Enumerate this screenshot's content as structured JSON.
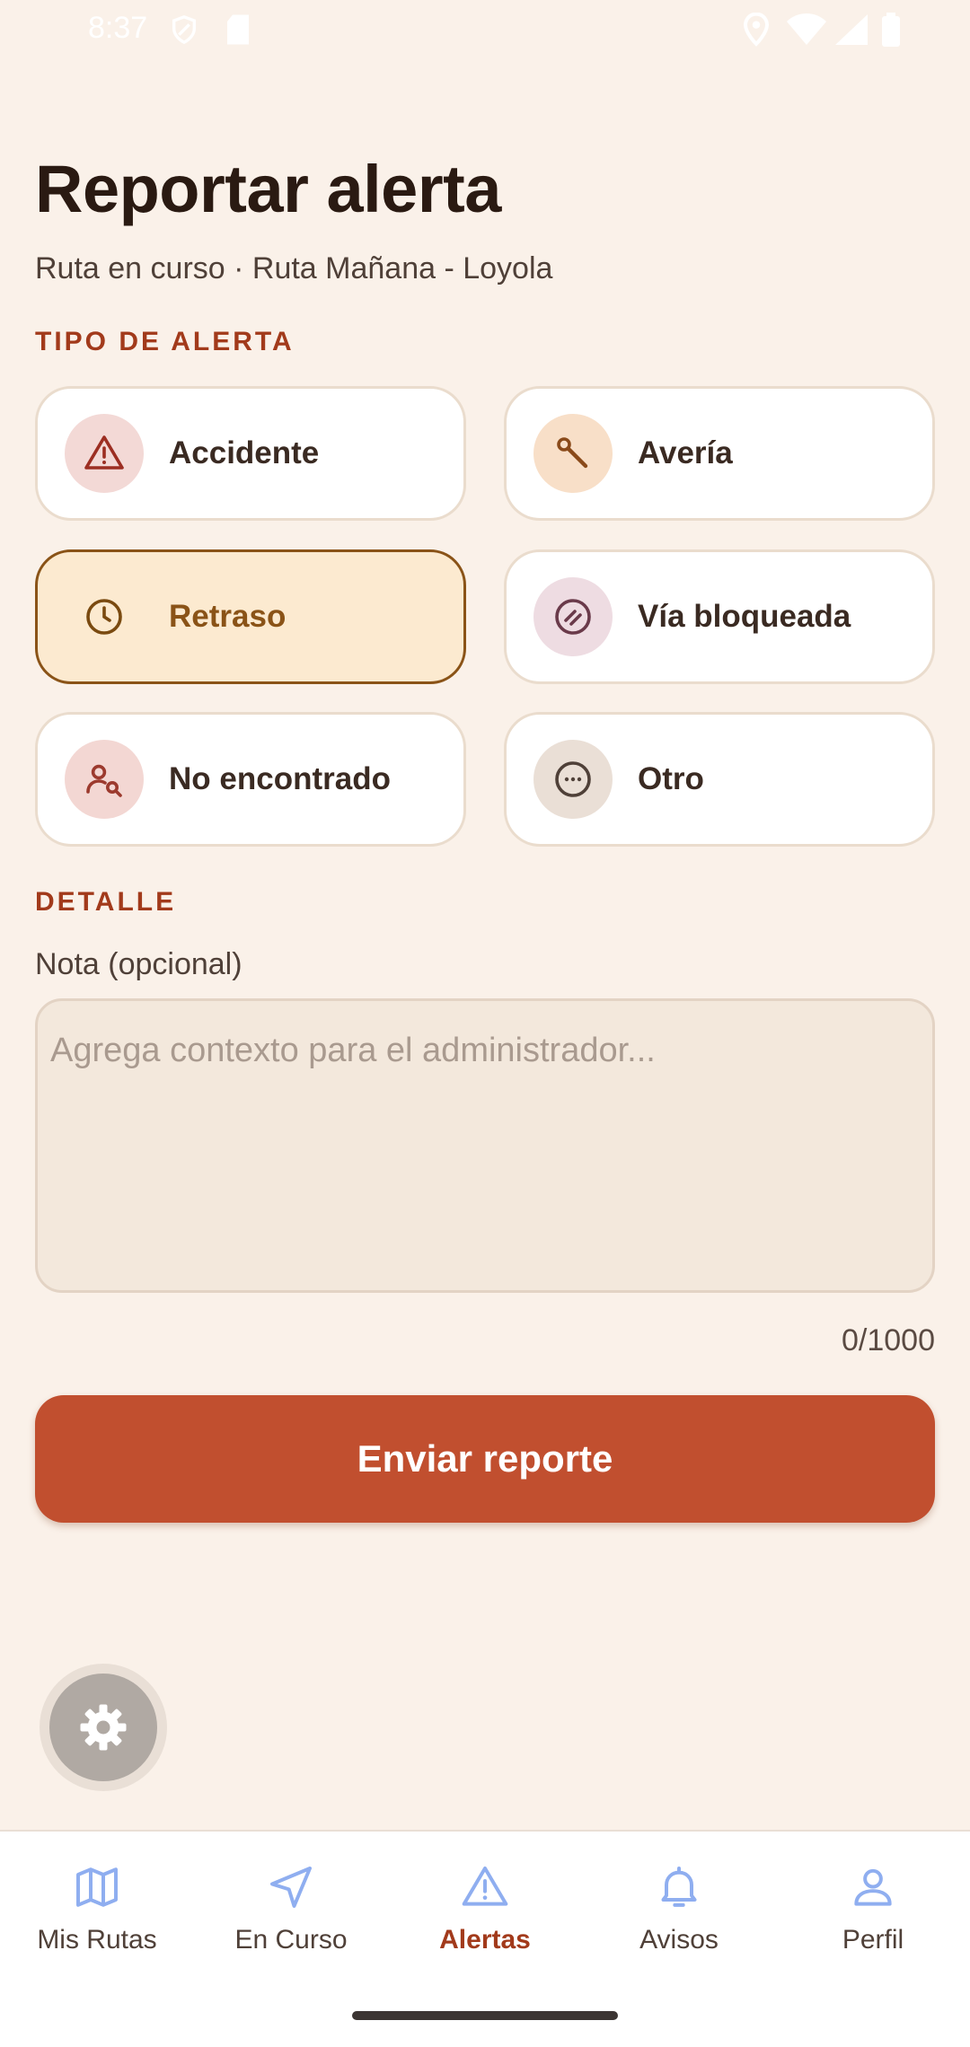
{
  "status_bar": {
    "time": "8:37"
  },
  "header": {
    "title": "Reportar alerta",
    "subtitle": "Ruta en curso · Ruta Mañana - Loyola"
  },
  "sections": {
    "type_label": "TIPO DE ALERTA",
    "detail_label": "DETALLE"
  },
  "alert_types": [
    {
      "label": "Accidente",
      "icon": "warning-icon",
      "icon_bg": "#F3D9D6",
      "icon_color": "#9C2E22",
      "selected": false
    },
    {
      "label": "Avería",
      "icon": "wrench-icon",
      "icon_bg": "#F8DFC8",
      "icon_color": "#8A4A1A",
      "selected": false
    },
    {
      "label": "Retraso",
      "icon": "clock-icon",
      "icon_bg": "#FCEAD0",
      "icon_color": "#7A4A10",
      "selected": true
    },
    {
      "label": "Vía bloqueada",
      "icon": "blocked-icon",
      "icon_bg": "#EEDCE2",
      "icon_color": "#6A3A4A",
      "selected": false
    },
    {
      "label": "No encontrado",
      "icon": "person-search-icon",
      "icon_bg": "#F3D7D3",
      "icon_color": "#9C3A2E",
      "selected": false
    },
    {
      "label": "Otro",
      "icon": "more-icon",
      "icon_bg": "#EADFD6",
      "icon_color": "#4F4038",
      "selected": false
    }
  ],
  "note": {
    "label": "Nota (opcional)",
    "placeholder": "Agrega contexto para el administrador...",
    "value": "",
    "counter": "0/1000"
  },
  "submit_label": "Enviar reporte",
  "fab": {
    "icon": "gear-icon"
  },
  "bottom_nav": [
    {
      "label": "Mis Rutas",
      "icon": "map-icon",
      "active": false
    },
    {
      "label": "En Curso",
      "icon": "navigation-icon",
      "active": false
    },
    {
      "label": "Alertas",
      "icon": "warning-icon",
      "active": true
    },
    {
      "label": "Avisos",
      "icon": "bell-icon",
      "active": false
    },
    {
      "label": "Perfil",
      "icon": "person-icon",
      "active": false
    }
  ],
  "colors": {
    "background": "#FAF1E9",
    "accent": "#C14F2F",
    "section_label": "#A23A1B",
    "selected_border": "#8A5317",
    "nav_icon": "#8FAEF0"
  }
}
